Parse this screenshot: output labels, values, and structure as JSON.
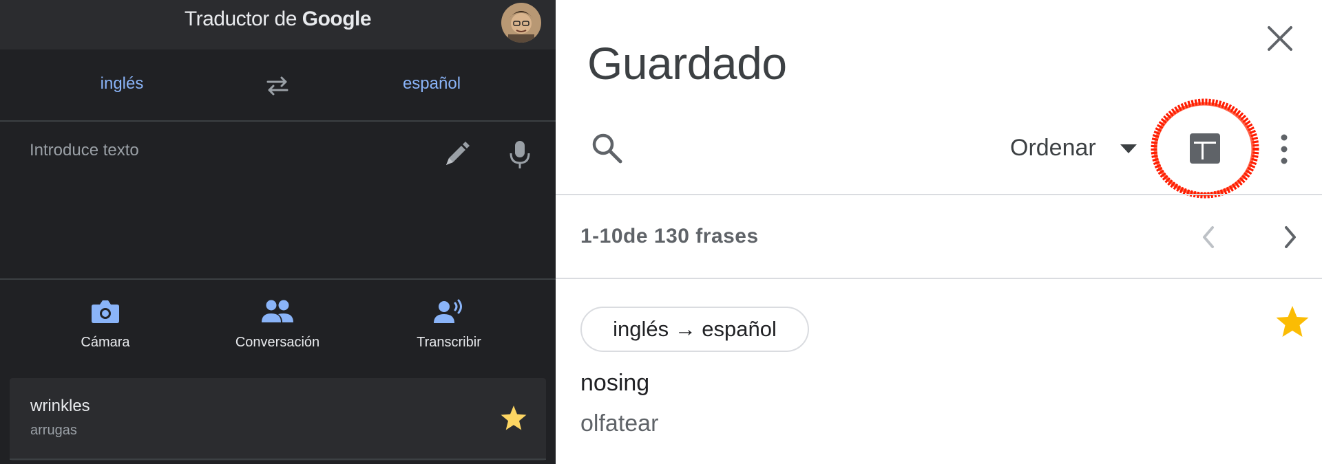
{
  "app": {
    "title_prefix": "Traductor de ",
    "title_brand": "Google"
  },
  "languages": {
    "source": "inglés",
    "target": "español"
  },
  "input": {
    "placeholder": "Introduce texto"
  },
  "modes": [
    {
      "label": "Cámara",
      "icon": "camera-icon"
    },
    {
      "label": "Conversación",
      "icon": "people-icon"
    },
    {
      "label": "Transcribir",
      "icon": "transcribe-icon"
    }
  ],
  "history": {
    "word": "wrinkles",
    "translation": "arrugas",
    "starred": true
  },
  "saved": {
    "title": "Guardado",
    "sort_label": "Ordenar",
    "count_text": "1-10de 130 frases",
    "item": {
      "lang_pair": "inglés → español",
      "phrase": "nosing",
      "translation": "olfatear",
      "starred": true
    }
  },
  "colors": {
    "accent": "#8ab4f8",
    "star": "#fdd663",
    "star_light": "#fbbc04",
    "highlight": "#ff1a00",
    "dark_bg": "#202124",
    "light_bg": "#ffffff"
  }
}
